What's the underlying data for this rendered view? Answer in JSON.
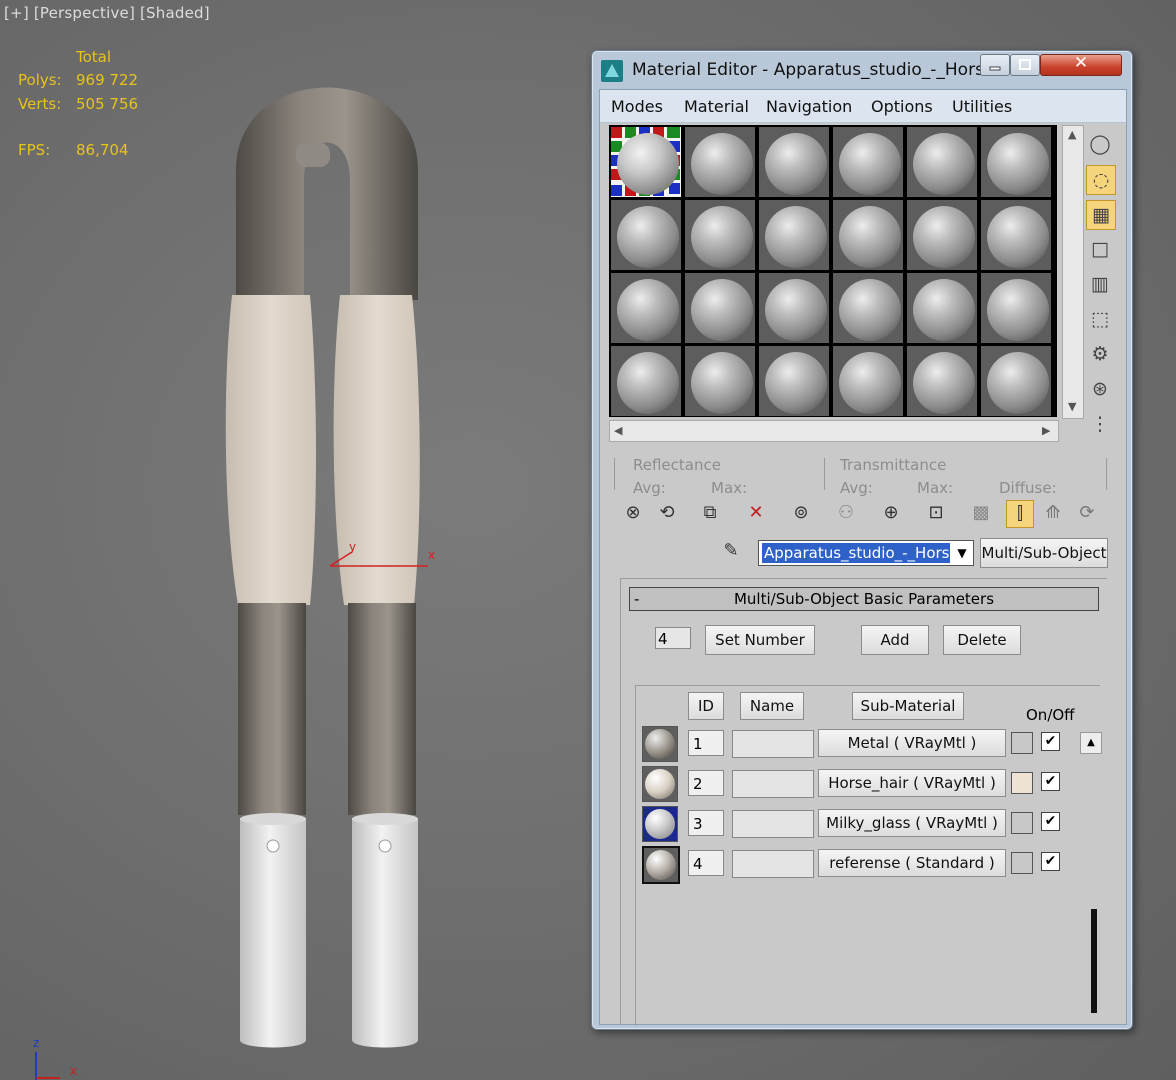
{
  "viewport": {
    "label": "[+] [Perspective] [Shaded]",
    "stats": {
      "total_label": "Total",
      "polys_label": "Polys:",
      "polys_value": "969 722",
      "verts_label": "Verts:",
      "verts_value": "505 756",
      "fps_label": "FPS:",
      "fps_value": "86,704"
    },
    "gizmo": {
      "x": "x",
      "y": "y"
    },
    "axis_tripod": {
      "z": "z",
      "x": "x"
    }
  },
  "window": {
    "title": "Material Editor - Apparatus_studio_-_Hors...",
    "close_glyph": "✕",
    "menu": [
      "Modes",
      "Material",
      "Navigation",
      "Options",
      "Utilities"
    ],
    "reflectance": {
      "label": "Reflectance",
      "avg": "Avg:",
      "max": "Max:"
    },
    "transmittance": {
      "label": "Transmittance",
      "avg": "Avg:",
      "max": "Max:",
      "diffuse": "Diffuse:"
    },
    "material_name": "Apparatus_studio_-_Horse",
    "material_type": "Multi/Sub-Object",
    "rollout": {
      "title": "Multi/Sub-Object Basic Parameters",
      "collapse": "-",
      "count": "4",
      "set_number": "Set Number",
      "add": "Add",
      "delete": "Delete",
      "headers": {
        "id": "ID",
        "name": "Name",
        "sub_material": "Sub-Material",
        "on_off": "On/Off"
      },
      "rows": [
        {
          "id": "1",
          "name": "",
          "sub_material": "Metal  ( VRayMtl )",
          "swatch": "#c8c8c8",
          "on": "✔",
          "thumb": "metal"
        },
        {
          "id": "2",
          "name": "",
          "sub_material": "Horse_hair  ( VRayMtl )",
          "swatch": "#efe3d6",
          "on": "✔",
          "thumb": "hair"
        },
        {
          "id": "3",
          "name": "",
          "sub_material": "Milky_glass  ( VRayMtl )",
          "swatch": "#c8c8c8",
          "on": "✔",
          "thumb": "glass"
        },
        {
          "id": "4",
          "name": "",
          "sub_material": "referense  ( Standard )",
          "swatch": "#c8c8c8",
          "on": "✔",
          "thumb": "ref"
        }
      ]
    }
  }
}
